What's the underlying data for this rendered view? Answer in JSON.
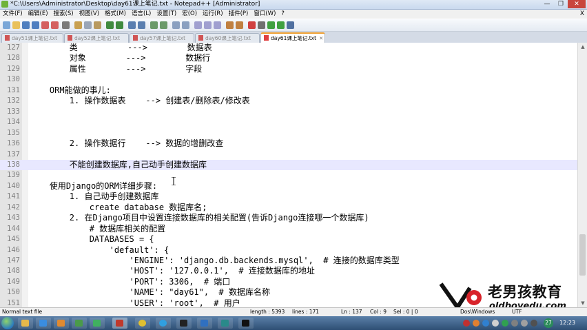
{
  "window": {
    "title": "*C:\\Users\\Administrator\\Desktop\\day61课上笔记.txt - Notepad++ [Administrator]",
    "min_label": "—",
    "max_label": "❐",
    "close_label": "✕"
  },
  "menu": {
    "items": [
      "文件(F)",
      "编辑(E)",
      "搜索(S)",
      "视图(V)",
      "格式(M)",
      "语言(L)",
      "设置(T)",
      "宏(O)",
      "运行(R)",
      "插件(P)",
      "窗口(W)",
      "?"
    ],
    "close_label": "X"
  },
  "tabs": [
    {
      "label": "day51课上笔记.txt",
      "active": false
    },
    {
      "label": "day52课上笔记.txt",
      "active": false
    },
    {
      "label": "day57课上笔记.txt",
      "active": false
    },
    {
      "label": "day60课上笔记.txt",
      "active": false
    },
    {
      "label": "day61课上笔记.txt",
      "active": true
    }
  ],
  "editor": {
    "current_line": 138,
    "lines": [
      {
        "num": "127",
        "text": "        类          --->        数据表"
      },
      {
        "num": "128",
        "text": "        对象        --->        数据行"
      },
      {
        "num": "129",
        "text": "        属性        --->        字段"
      },
      {
        "num": "130",
        "text": ""
      },
      {
        "num": "131",
        "text": "    ORM能做的事儿:"
      },
      {
        "num": "132",
        "text": "        1. 操作数据表    --> 创建表/删除表/修改表"
      },
      {
        "num": "133",
        "text": ""
      },
      {
        "num": "134",
        "text": ""
      },
      {
        "num": "135",
        "text": ""
      },
      {
        "num": "136",
        "text": "        2. 操作数据行    --> 数据的增删改查"
      },
      {
        "num": "137",
        "text": ""
      },
      {
        "num": "138",
        "text": "        不能创建数据库,自己动手创建数据库"
      },
      {
        "num": "139",
        "text": ""
      },
      {
        "num": "140",
        "text": "    使用Django的ORM详细步骤:"
      },
      {
        "num": "141",
        "text": "        1. 自己动手创建数据库"
      },
      {
        "num": "142",
        "text": "            create database 数据库名;"
      },
      {
        "num": "143",
        "text": "        2. 在Django项目中设置连接数据库的相关配置(告诉Django连接哪一个数据库)"
      },
      {
        "num": "144",
        "text": "            # 数据库相关的配置"
      },
      {
        "num": "145",
        "text": "            DATABASES = {"
      },
      {
        "num": "146",
        "text": "                'default': {"
      },
      {
        "num": "147",
        "text": "                    'ENGINE': 'django.db.backends.mysql',  # 连接的数据库类型"
      },
      {
        "num": "148",
        "text": "                    'HOST': '127.0.0.1',  # 连接数据库的地址"
      },
      {
        "num": "149",
        "text": "                    'PORT': 3306,  # 端口"
      },
      {
        "num": "150",
        "text": "                    'NAME': \"day61\",  # 数据库名称"
      },
      {
        "num": "151",
        "text": "                    'USER': 'root',  # 用户"
      }
    ]
  },
  "status": {
    "type": "Normal text file",
    "length": "length : 5393",
    "lines": "lines : 171",
    "ln": "Ln : 137",
    "col": "Col : 9",
    "sel": "Sel : 0 | 0",
    "eol": "Dos\\Windows",
    "enc": "UTF"
  },
  "taskbar": {
    "badge": "27",
    "clock": "12:23"
  },
  "watermark": {
    "title": "老男孩教育",
    "url": "oldboyedu.com"
  },
  "colors": {
    "accent_tab": "#f0a030",
    "current_line": "#e8e8ff",
    "gutter": "#e4e4e4"
  }
}
